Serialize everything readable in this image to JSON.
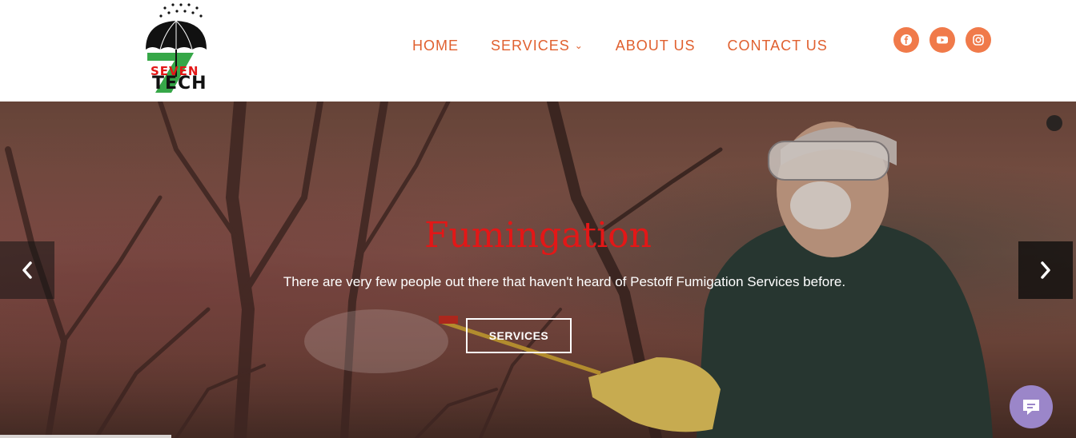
{
  "brand": {
    "logo_line1": "SEVEN",
    "logo_line2": "TECH",
    "logo_numeral": "7"
  },
  "nav": {
    "items": [
      {
        "label": "HOME"
      },
      {
        "label": "SERVICES"
      },
      {
        "label": "ABOUT US"
      },
      {
        "label": "CONTACT US"
      }
    ]
  },
  "social": [
    {
      "icon": "facebook-icon"
    },
    {
      "icon": "youtube-icon"
    },
    {
      "icon": "instagram-icon"
    }
  ],
  "hero": {
    "title": "Fumingation",
    "subtitle": "There are very few people out there that haven't heard of Pestoff Fumigation Services before.",
    "button_label": "SERVICES"
  },
  "colors": {
    "accent": "#e0602f",
    "social_bg": "#f07a4a",
    "title_red": "#e31717",
    "chat_bg": "#9b86c9"
  }
}
